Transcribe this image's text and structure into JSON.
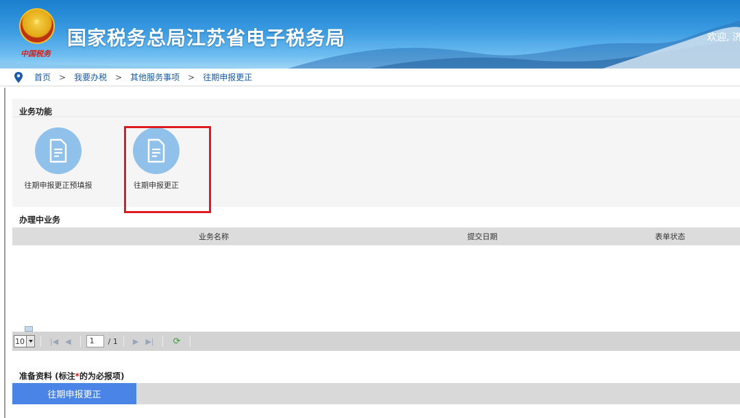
{
  "header": {
    "site_title": "国家税务总局江苏省电子税务局",
    "welcome": "欢迎, 济",
    "emblem_sub": "中国税务",
    "emblem_icon": "national-emblem-icon"
  },
  "breadcrumb": {
    "icon": "location-pin-icon",
    "items": [
      "首页",
      "我要办税",
      "其他服务事项",
      "往期申报更正"
    ],
    "separator": ">"
  },
  "business_functions": {
    "title": "业务功能",
    "items": [
      {
        "label": "往期申报更正预填报",
        "icon": "document-icon"
      },
      {
        "label": "往期申报更正",
        "icon": "document-icon",
        "highlighted": true
      }
    ]
  },
  "in_process": {
    "title": "办理中业务",
    "columns": [
      "业务名称",
      "提交日期",
      "表单状态"
    ],
    "rows": []
  },
  "pager": {
    "page_size": "10",
    "current_page": "1",
    "total_pages": "/ 1"
  },
  "preparation": {
    "title_prefix": "准备资料 (标注",
    "required_mark": "*",
    "title_suffix": "的为必报项)",
    "tabs": [
      {
        "label": "往期申报更正",
        "active": true
      }
    ]
  },
  "colors": {
    "accent": "#4a84e6",
    "highlight_border": "#e0191f",
    "icon_circle": "#8fc1ea"
  }
}
